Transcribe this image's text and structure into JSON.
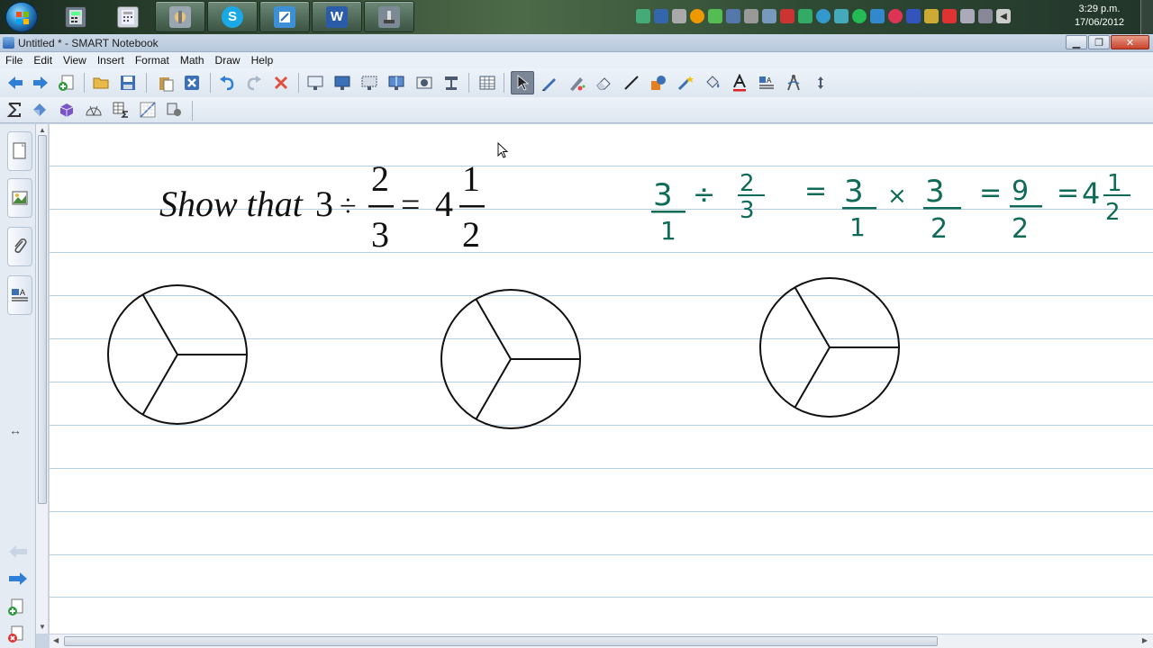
{
  "taskbar": {
    "apps": [
      {
        "name": "calculator",
        "icon": "calculator-icon"
      },
      {
        "name": "calculator-2",
        "icon": "calculator-icon"
      },
      {
        "name": "utilities",
        "icon": "tools-icon"
      },
      {
        "name": "skype",
        "icon": "skype-icon",
        "glyph": "S"
      },
      {
        "name": "notebook",
        "icon": "notebook-icon"
      },
      {
        "name": "word",
        "icon": "word-icon",
        "glyph": "W"
      },
      {
        "name": "document-camera",
        "icon": "camera-icon"
      }
    ],
    "clock_time": "3:29 p.m.",
    "clock_date": "17/06/2012"
  },
  "window": {
    "title": "Untitled * - SMART Notebook"
  },
  "menu": {
    "items": [
      "File",
      "Edit",
      "View",
      "Insert",
      "Format",
      "Math",
      "Draw",
      "Help"
    ]
  },
  "canvas": {
    "typed_equation": {
      "prefix": "Show that",
      "whole": "3",
      "divide_sign": "÷",
      "fraction_num": "2",
      "fraction_den": "3",
      "equals_sign": "=",
      "result_whole": "4",
      "result_num": "1",
      "result_den": "2"
    },
    "handwritten": {
      "f1_num": "3",
      "f1_den": "1",
      "divide_sign": "÷",
      "f2_num": "2",
      "f2_den": "3",
      "eq1": "=",
      "f3_num": "3",
      "f3_den": "1",
      "times_sign": "×",
      "f4_num": "3",
      "f4_den": "2",
      "eq2": "=",
      "f5_num": "9",
      "f5_den": "2",
      "eq3": "=",
      "result_whole": "4",
      "result_num": "1",
      "result_den": "2"
    },
    "circles": [
      {
        "label": "circle-1",
        "parts": 3
      },
      {
        "label": "circle-2",
        "parts": 3
      },
      {
        "label": "circle-3",
        "parts": 3
      }
    ]
  },
  "colors": {
    "ink_green": "#0f6b57",
    "ruled_line": "#b7cde2"
  }
}
